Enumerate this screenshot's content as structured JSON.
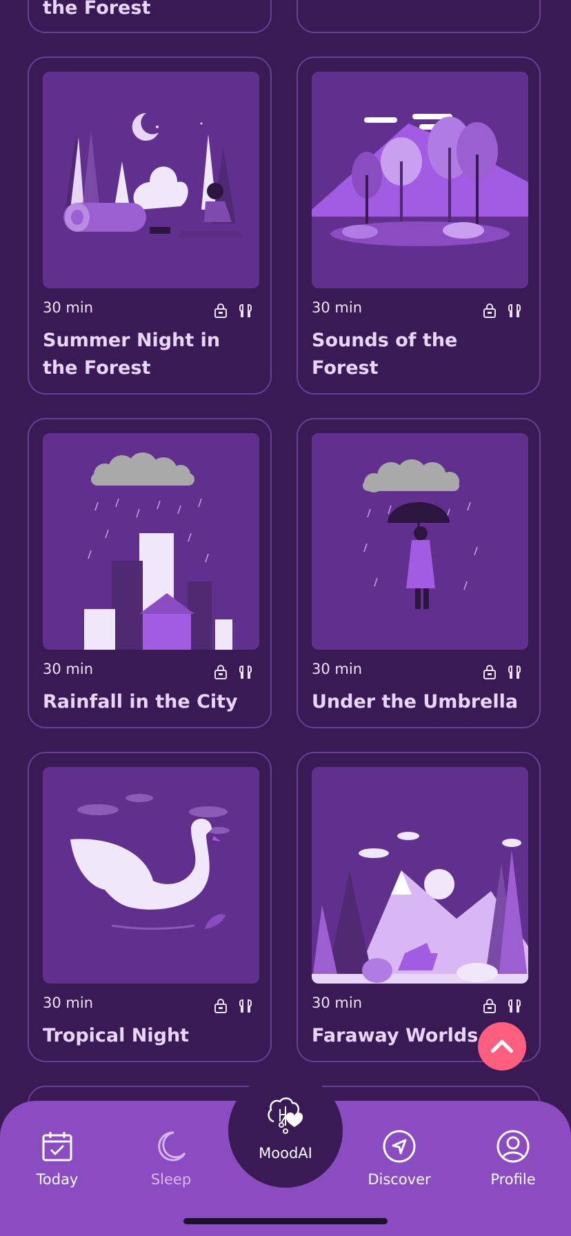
{
  "cards": [
    {
      "title": "the Forest",
      "duration": ""
    },
    {
      "title": "",
      "duration": ""
    },
    {
      "title": "Summer Night in the Forest",
      "duration": "30 min"
    },
    {
      "title": "Sounds of the Forest",
      "duration": "30 min"
    },
    {
      "title": "Rainfall in the City",
      "duration": "30 min"
    },
    {
      "title": "Under the Umbrella",
      "duration": "30 min"
    },
    {
      "title": "Tropical Night",
      "duration": "30 min"
    },
    {
      "title": "Faraway Worlds",
      "duration": "30 min"
    }
  ],
  "tabs": {
    "today": "Today",
    "sleep": "Sleep",
    "moodai": "MoodAI",
    "discover": "Discover",
    "profile": "Profile"
  },
  "colors": {
    "background": "#3a1a55",
    "card_border": "#6b3f98",
    "tabbar": "#8a4cc0",
    "fab": "#ff5f7e"
  }
}
